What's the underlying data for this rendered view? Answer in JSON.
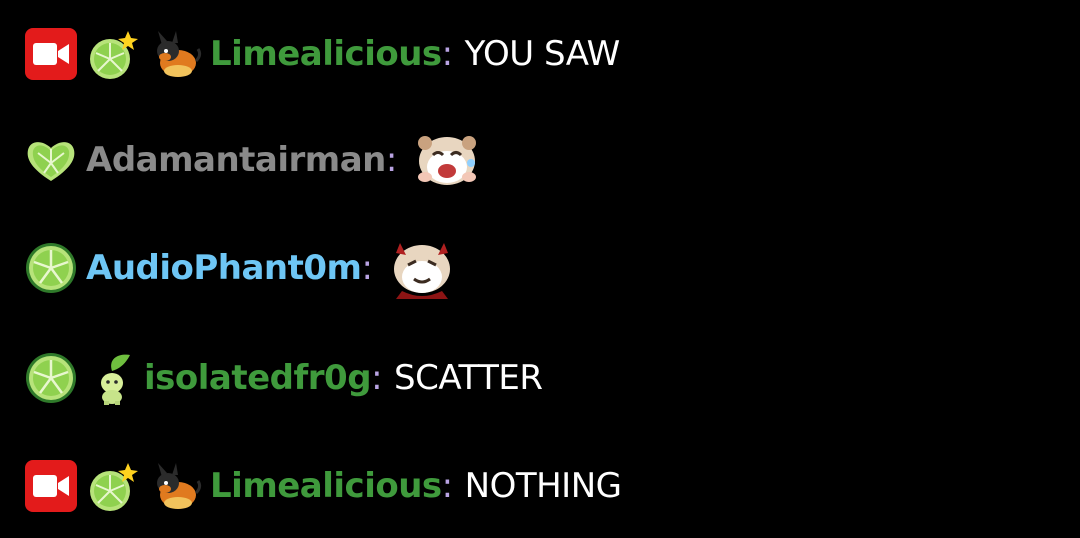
{
  "messages": [
    {
      "badges": [
        "video-camera-icon",
        "lime-sparkle-icon",
        "pokemon-tepig-icon"
      ],
      "username": "Limealicious",
      "username_color": "#3f9a3c",
      "separator": ":",
      "text": "YOU SAW"
    },
    {
      "badges": [
        "lime-heart-icon"
      ],
      "username": "Adamantairman",
      "username_color": "#8a8a8a",
      "separator": ":",
      "emote": "laughing-hamster-emote"
    },
    {
      "badges": [
        "lime-slice-icon"
      ],
      "username": "AudioPhant0m",
      "username_color": "#6ec6f5",
      "separator": ":",
      "emote": "devil-hamster-emote"
    },
    {
      "badges": [
        "lime-slice-icon",
        "pokemon-chikorita-icon"
      ],
      "username": "isolatedfr0g",
      "username_color": "#3f9a3c",
      "separator": ":",
      "text": "SCATTER"
    },
    {
      "badges": [
        "video-camera-icon",
        "lime-sparkle-icon",
        "pokemon-tepig-icon"
      ],
      "username": "Limealicious",
      "username_color": "#3f9a3c",
      "separator": ":",
      "text": "NOTHING"
    }
  ],
  "colors": {
    "background": "#000000",
    "separator": "#b9a3e3",
    "message_text": "#ffffff",
    "camera_badge": "#e31b1b",
    "lime": "#8fd14f"
  }
}
